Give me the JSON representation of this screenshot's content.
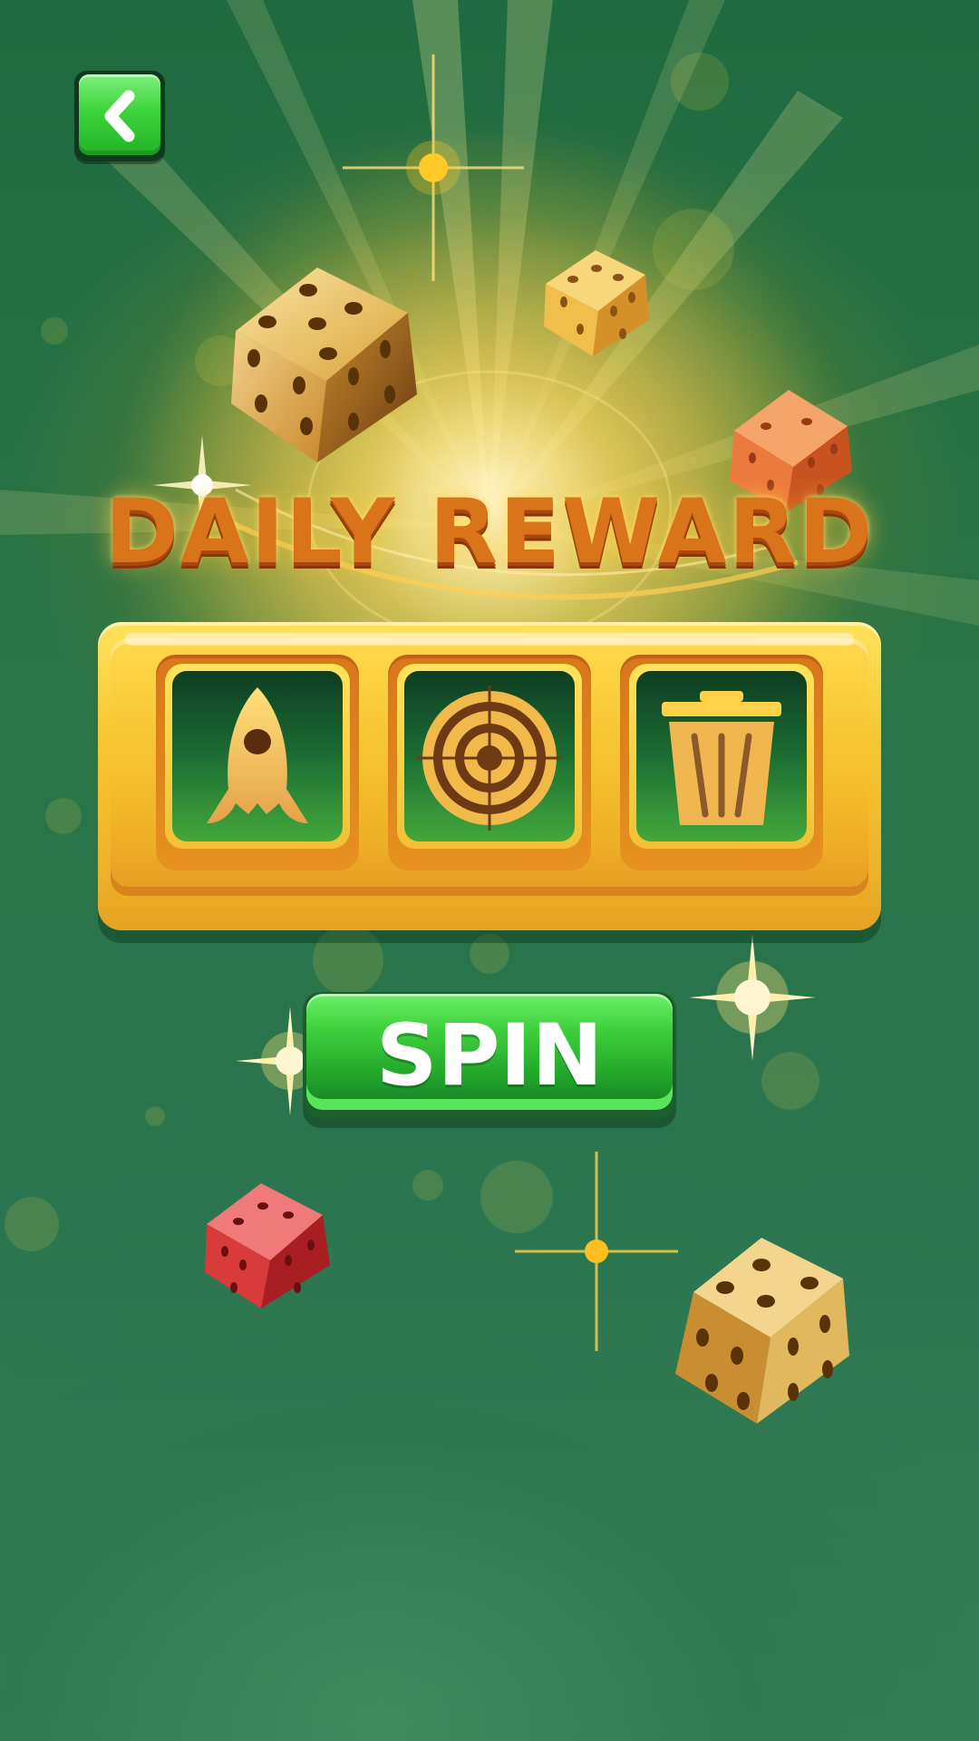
{
  "screen": {
    "title": "DAILY REWARD",
    "back_button_icon": "chevron-left-icon"
  },
  "slot_machine": {
    "reels": [
      {
        "symbol": "rocket-icon"
      },
      {
        "symbol": "target-icon"
      },
      {
        "symbol": "trash-can-icon"
      }
    ]
  },
  "spin_button": {
    "label": "SPIN"
  },
  "decorations": {
    "dice": [
      "gold-die",
      "gold-die",
      "orange-die",
      "red-die",
      "gold-die"
    ],
    "sparkles": 5
  },
  "colors": {
    "background": "#2a7447",
    "title": "#d9741a",
    "panel_gold": "#f7c531",
    "spin_green": "#3fd13d",
    "back_green": "#3dd43a"
  }
}
